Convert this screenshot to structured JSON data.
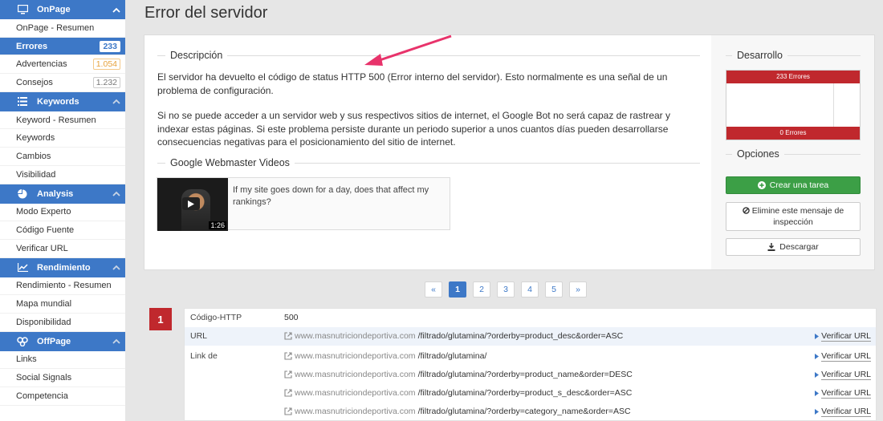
{
  "sidebar": {
    "sections": [
      {
        "title": "OnPage",
        "icon": "monitor-icon",
        "items": [
          {
            "label": "OnPage - Resumen"
          },
          {
            "label": "Errores",
            "badge": "233",
            "active": true
          },
          {
            "label": "Advertencias",
            "badge": "1.054"
          },
          {
            "label": "Consejos",
            "badge": "1.232"
          }
        ]
      },
      {
        "title": "Keywords",
        "icon": "list-icon",
        "items": [
          {
            "label": "Keyword - Resumen"
          },
          {
            "label": "Keywords"
          },
          {
            "label": "Cambios"
          },
          {
            "label": "Visibilidad"
          }
        ]
      },
      {
        "title": "Analysis",
        "icon": "pie-chart-icon",
        "items": [
          {
            "label": "Modo Experto"
          },
          {
            "label": "Código Fuente"
          },
          {
            "label": "Verificar URL"
          }
        ]
      },
      {
        "title": "Rendimiento",
        "icon": "line-chart-icon",
        "items": [
          {
            "label": "Rendimiento - Resumen"
          },
          {
            "label": "Mapa mundial"
          },
          {
            "label": "Disponibilidad"
          }
        ]
      },
      {
        "title": "OffPage",
        "icon": "network-icon",
        "items": [
          {
            "label": "Links"
          },
          {
            "label": "Social Signals"
          },
          {
            "label": "Competencia"
          }
        ]
      }
    ]
  },
  "page": {
    "title": "Error del servidor"
  },
  "description": {
    "heading": "Descripción",
    "p1": "El servidor ha devuelto el código de status HTTP 500 (Error interno del servidor). Esto normalmente es una señal de un problema de configuración.",
    "p2": "Si no se puede acceder a un servidor web y sus respectivos sitios de internet, el Google Bot no será capaz de rastrear y indexar estas páginas. Si este problema persiste durante un periodo superior a unos cuantos días pueden desarrollarse consecuencias negativas para el posicionamiento del sitio de internet."
  },
  "videos": {
    "heading": "Google Webmaster Videos",
    "item": {
      "title": "If my site goes down for a day, does that affect my rankings?",
      "duration": "1:26"
    }
  },
  "development": {
    "heading": "Desarrollo",
    "top_bar": "233 Errores",
    "bottom_bar": "0 Errores"
  },
  "options": {
    "heading": "Opciones",
    "create_task": "Crear una tarea",
    "remove_message": "Elimine este mensaje de inspección",
    "download": "Descargar"
  },
  "pagination": {
    "prev": "«",
    "pages": [
      "1",
      "2",
      "3",
      "4",
      "5"
    ],
    "next": "»",
    "current": "1"
  },
  "result": {
    "number": "1",
    "http_label": "Código-HTTP",
    "http_value": "500",
    "url_label": "URL",
    "link_label": "Link de",
    "verify_label": "Verificar URL",
    "domain": "www.masnutriciondeportiva.com",
    "url_path": "/filtrado/glutamina/?orderby=product_desc&order=ASC",
    "links": [
      "/filtrado/glutamina/",
      "/filtrado/glutamina/?orderby=product_name&order=DESC",
      "/filtrado/glutamina/?orderby=product_s_desc&order=ASC",
      "/filtrado/glutamina/?orderby=category_name&order=ASC"
    ]
  },
  "colors": {
    "accent": "#3d78c7",
    "error": "#c0282d",
    "success": "#3c9f46"
  }
}
